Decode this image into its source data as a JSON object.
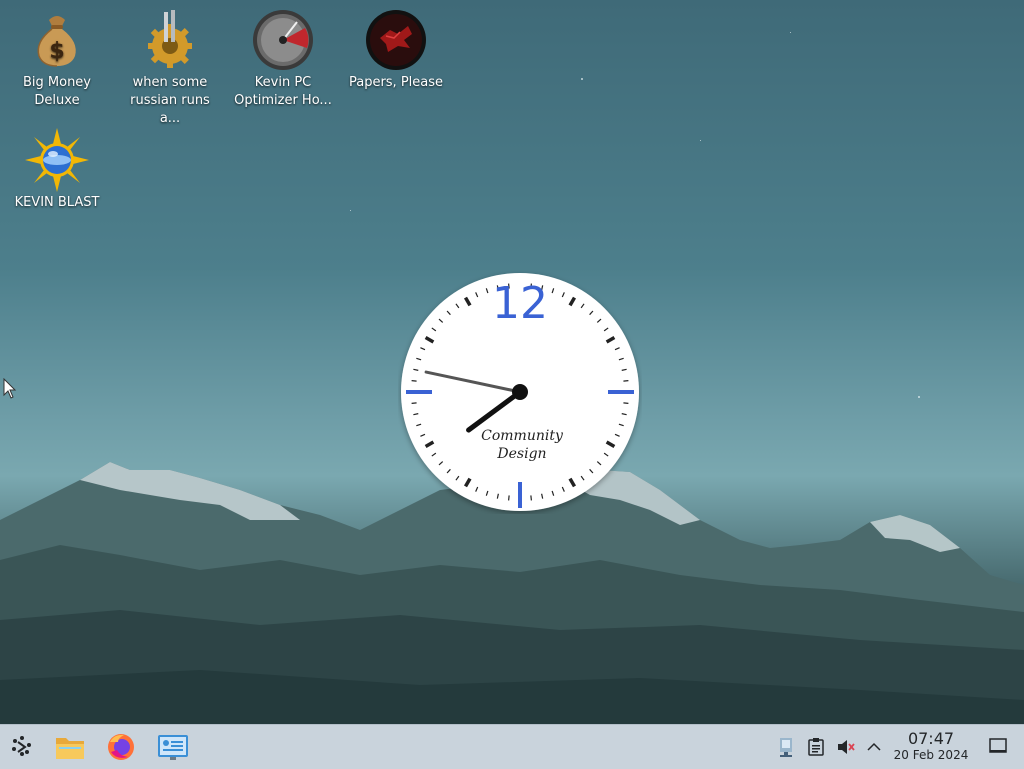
{
  "desktop": {
    "icons": [
      {
        "label_line1": "Big Money",
        "label_line2": "Deluxe",
        "icon": "money-bag-icon"
      },
      {
        "label_line1": "when some",
        "label_line2": "russian runs a...",
        "icon": "gear-icon"
      },
      {
        "label_line1": "Kevin PC",
        "label_line2": "Optimizer Ho...",
        "icon": "speedometer-icon"
      },
      {
        "label_line1": "Papers, Please",
        "label_line2": "",
        "icon": "papers-please-icon"
      },
      {
        "label_line1": "KEVIN BLAST",
        "label_line2": "",
        "icon": "sun-globe-icon"
      }
    ]
  },
  "clock": {
    "twelve": "12",
    "brand_line1": "Community",
    "brand_line2": "Design",
    "accent": "#3a62d4",
    "hour": 7,
    "minute": 47
  },
  "taskbar": {
    "apps": [
      {
        "name": "application-launcher",
        "icon": "kde-launcher-icon"
      },
      {
        "name": "file-manager",
        "icon": "folder-icon"
      },
      {
        "name": "firefox",
        "icon": "firefox-icon"
      },
      {
        "name": "system-settings",
        "icon": "settings-icon"
      }
    ],
    "tray": [
      {
        "name": "network",
        "icon": "network-icon"
      },
      {
        "name": "clipboard",
        "icon": "clipboard-icon"
      },
      {
        "name": "volume-muted",
        "icon": "speaker-muted-icon"
      },
      {
        "name": "show-hidden",
        "icon": "chevron-up-icon"
      }
    ],
    "time": "07:47",
    "date": "20 Feb 2024"
  }
}
